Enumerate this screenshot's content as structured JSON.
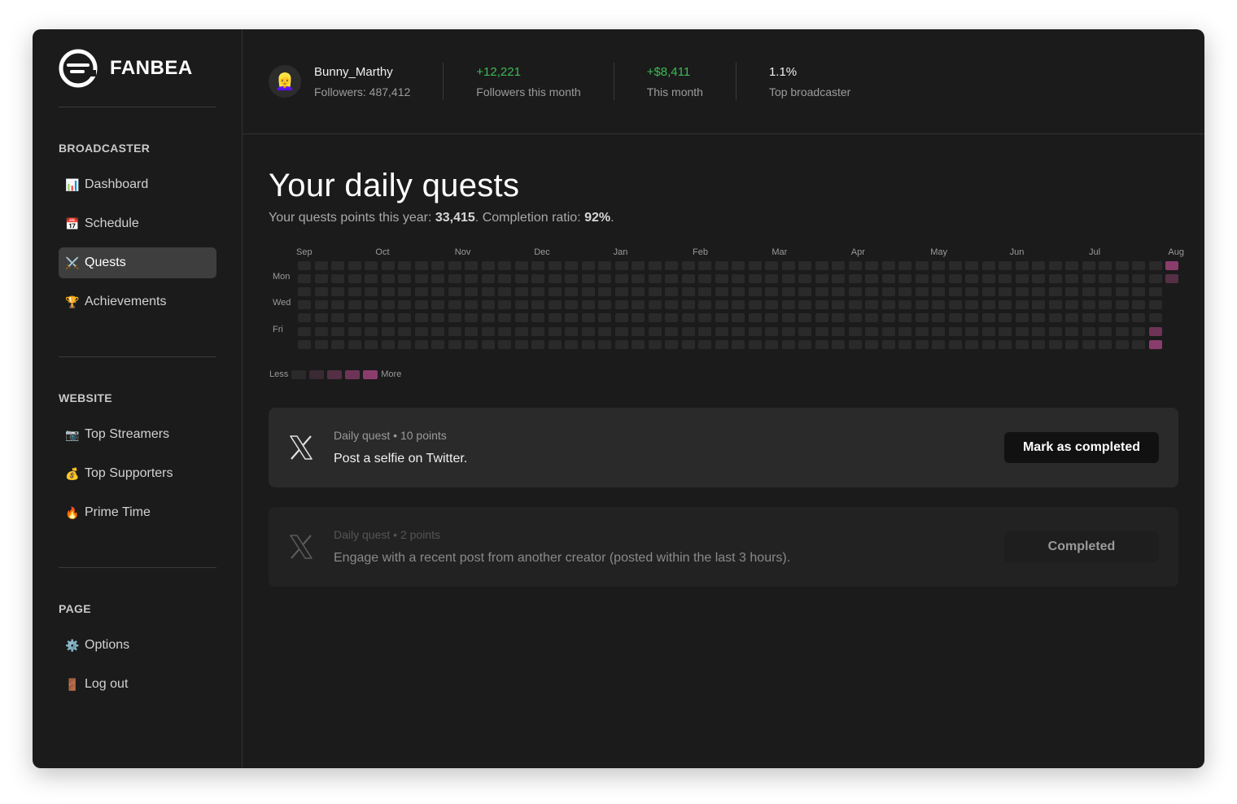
{
  "brand": {
    "name": "FANBEA"
  },
  "sidebar": {
    "sections": [
      {
        "heading": "BROADCASTER",
        "items": [
          {
            "label": "Dashboard",
            "icon": "📊",
            "icon_name": "chart-icon",
            "active": false
          },
          {
            "label": "Schedule",
            "icon": "📅",
            "icon_name": "calendar-icon",
            "active": false
          },
          {
            "label": "Quests",
            "icon": "⚔️",
            "icon_name": "swords-icon",
            "active": true
          },
          {
            "label": "Achievements",
            "icon": "🏆",
            "icon_name": "trophy-icon",
            "active": false
          }
        ]
      },
      {
        "heading": "WEBSITE",
        "items": [
          {
            "label": "Top Streamers",
            "icon": "📷",
            "icon_name": "camera-icon",
            "active": false
          },
          {
            "label": "Top Supporters",
            "icon": "💰",
            "icon_name": "money-bag-icon",
            "active": false
          },
          {
            "label": "Prime Time",
            "icon": "🔥",
            "icon_name": "fire-icon",
            "active": false
          }
        ]
      },
      {
        "heading": "PAGE",
        "items": [
          {
            "label": "Options",
            "icon": "⚙️",
            "icon_name": "gear-icon",
            "active": false
          },
          {
            "label": "Log out",
            "icon": "🚪",
            "icon_name": "door-icon",
            "active": false
          }
        ]
      }
    ]
  },
  "stats": {
    "avatar": "👱‍♀️",
    "user": {
      "name": "Bunny_Marthy",
      "followers_label": "Followers: 487,412"
    },
    "followers_month": {
      "value": "+12,221",
      "label": "Followers this month"
    },
    "earnings_month": {
      "value": "+$8,411",
      "label": "This month"
    },
    "rank": {
      "value": "1.1%",
      "label": "Top broadcaster"
    }
  },
  "page": {
    "title": "Your daily quests",
    "sub_prefix": "Your quests points this year: ",
    "points": "33,415",
    "sub_mid": ". Completion ratio: ",
    "ratio": "92%",
    "sub_suffix": "."
  },
  "heatmap": {
    "months": [
      "Sep",
      "Oct",
      "Nov",
      "Dec",
      "Jan",
      "Feb",
      "Mar",
      "Apr",
      "May",
      "Jun",
      "Jul",
      "Aug"
    ],
    "days": [
      "Mon",
      "Wed",
      "Fri"
    ],
    "weeks": 53,
    "rows": 7,
    "active_cells": [
      {
        "week": 53,
        "row": 0,
        "level": 4
      },
      {
        "week": 53,
        "row": 1,
        "level": 2
      },
      {
        "week": 52,
        "row": 5,
        "level": 3
      },
      {
        "week": 52,
        "row": 6,
        "level": 4
      }
    ],
    "colors": [
      "#2a2a2a",
      "#3a2a33",
      "#552f45",
      "#6e3457",
      "#8a3d6c"
    ],
    "legend_less": "Less",
    "legend_more": "More"
  },
  "quests": [
    {
      "type": "Daily quest",
      "points": "10 points",
      "title": "Post a selfie on Twitter.",
      "button": "Mark as completed",
      "done": false
    },
    {
      "type": "Daily quest",
      "points": "2 points",
      "title": "Engage with a recent post from another creator (posted within the last 3 hours).",
      "button": "Completed",
      "done": true
    }
  ]
}
